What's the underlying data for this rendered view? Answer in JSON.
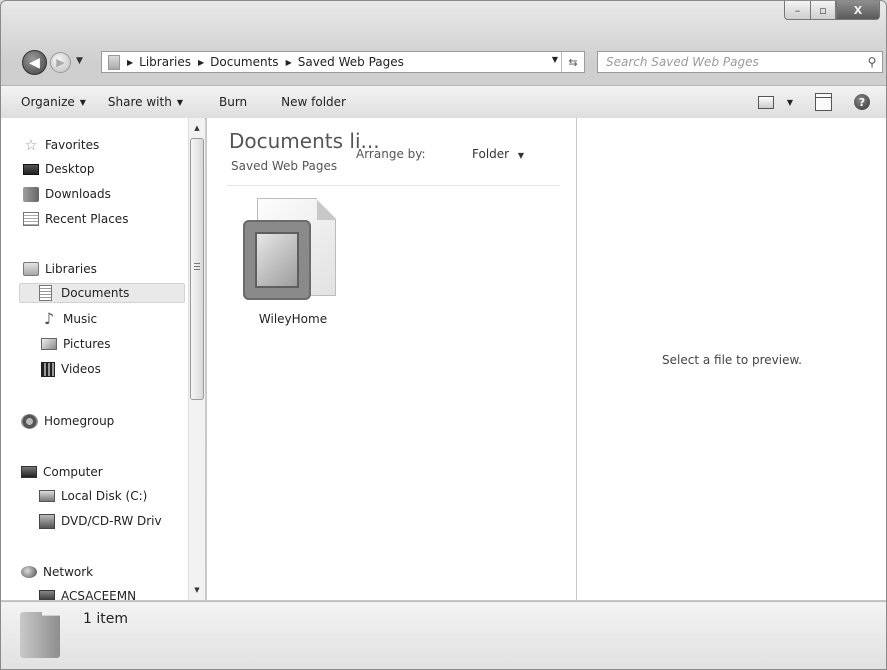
{
  "window": {
    "caption": {
      "minimize": "–",
      "maximize": "▫",
      "close": "X"
    }
  },
  "address_bar": {
    "crumbs": [
      "Libraries",
      "Documents",
      "Saved Web Pages"
    ]
  },
  "search": {
    "placeholder": "Search Saved Web Pages"
  },
  "toolbar": {
    "organize": "Organize",
    "share_with": "Share with",
    "burn": "Burn",
    "new_folder": "New folder"
  },
  "nav": {
    "favorites": "Favorites",
    "desktop": "Desktop",
    "downloads": "Downloads",
    "recent_places": "Recent Places",
    "libraries": "Libraries",
    "documents": "Documents",
    "music": "Music",
    "pictures": "Pictures",
    "videos": "Videos",
    "homegroup": "Homegroup",
    "computer": "Computer",
    "local_disk": "Local Disk (C:)",
    "dvd_drive": "DVD/CD-RW Driv",
    "network": "Network",
    "network_pc": "ACSACEEMN"
  },
  "content": {
    "title": "Documents li...",
    "subtitle": "Saved Web Pages",
    "arrange_label": "Arrange by:",
    "arrange_value": "Folder",
    "files": [
      {
        "name": "WileyHome"
      }
    ]
  },
  "preview": {
    "message": "Select a file to preview."
  },
  "details": {
    "count": "1 item"
  }
}
